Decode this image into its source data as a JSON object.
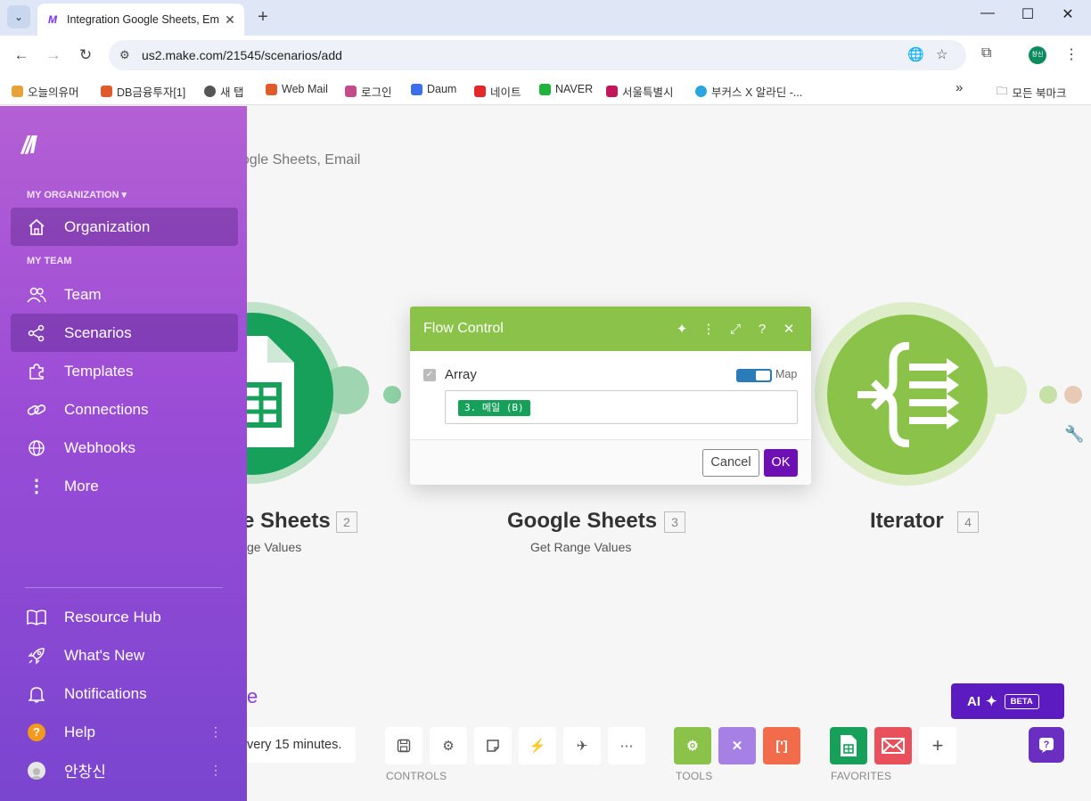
{
  "browser": {
    "tab_title": "Integration Google Sheets, Em",
    "url": "us2.make.com/21545/scenarios/add",
    "profile_initials": "창신",
    "bookmarks": [
      {
        "label": "오늘의유머",
        "color": "#e8a23a"
      },
      {
        "label": "DB금융투자[1]",
        "color": "#e05b2a"
      },
      {
        "label": "새 탭",
        "color": "#555555"
      },
      {
        "label": "Web Mail",
        "color": "#e05b2a"
      },
      {
        "label": "로그인",
        "color": "#c44b8a"
      },
      {
        "label": "Daum",
        "color": "#3b6ee8"
      },
      {
        "label": "네이트",
        "color": "#e32828"
      },
      {
        "label": "NAVER",
        "color": "#1fb33c"
      },
      {
        "label": "서울특별시",
        "color": "#c2185b"
      },
      {
        "label": "부커스 X 알라딘 -...",
        "color": "#2aa5e0"
      }
    ],
    "bookmarks_folder": "모든 북마크"
  },
  "canvas": {
    "breadcrumb": "oogle Sheets, Email",
    "modules": [
      {
        "name": "e Sheets",
        "num": "2",
        "sub": "ge Values"
      },
      {
        "name": "Google Sheets",
        "num": "3",
        "sub": "Get Range Values"
      },
      {
        "name": "Iterator",
        "num": "4",
        "sub": ""
      }
    ],
    "partial_text": "e"
  },
  "sidebar": {
    "org_section": "MY ORGANIZATION ▾",
    "team_section": "MY TEAM",
    "items": {
      "organization": "Organization",
      "team": "Team",
      "scenarios": "Scenarios",
      "templates": "Templates",
      "connections": "Connections",
      "webhooks": "Webhooks",
      "more": "More",
      "resource_hub": "Resource Hub",
      "whats_new": "What's New",
      "notifications": "Notifications",
      "help": "Help",
      "user": "안창신"
    }
  },
  "dialog": {
    "title": "Flow Control",
    "field_label": "Array",
    "map_label": "Map",
    "map_enabled": true,
    "token": "3. 메일 (B)",
    "cancel": "Cancel",
    "ok": "OK"
  },
  "toolbar": {
    "schedule": "very 15 minutes.",
    "controls_label": "CONTROLS",
    "tools_label": "TOOLS",
    "favorites_label": "FAVORITES",
    "ai_label": "AI",
    "beta_label": "BETA"
  },
  "colors": {
    "accent": "#6d0fb3",
    "flow_control": "#8bc34a",
    "sheets": "#0f9d58"
  }
}
